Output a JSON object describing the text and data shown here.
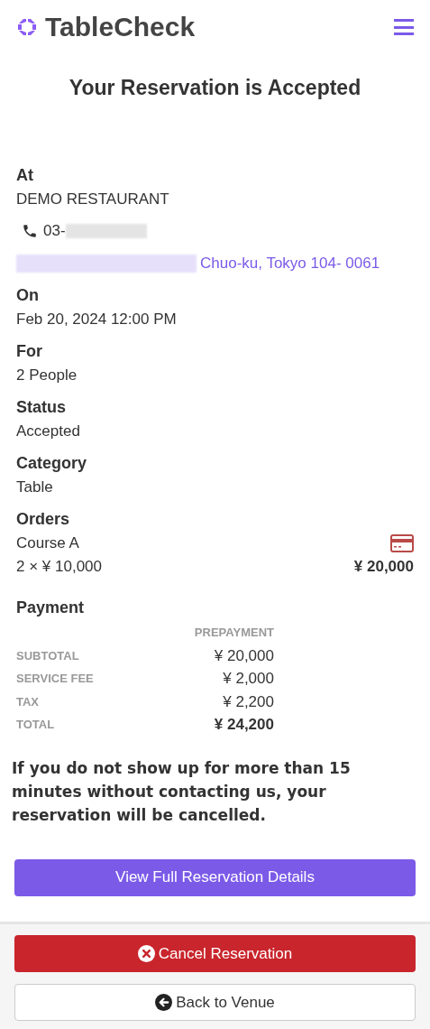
{
  "header": {
    "logo": "TableCheck"
  },
  "title": "Your Reservation is Accepted",
  "venue": {
    "label": "At",
    "name": "DEMO RESTAURANT",
    "phone": "03-",
    "address": "Chuo-ku, Tokyo 104- 0061"
  },
  "fields": [
    {
      "label": "On",
      "value": "Feb 20, 2024 12:00 PM"
    },
    {
      "label": "For",
      "value": "2 People"
    },
    {
      "label": "Status",
      "value": "Accepted"
    },
    {
      "label": "Category",
      "value": "Table"
    }
  ],
  "orders": {
    "label": "Orders",
    "items": [
      {
        "name": "Course A",
        "quantity_price": "2 × ¥ 10,000",
        "total": "¥ 20,000"
      }
    ]
  },
  "payment": {
    "label": "Payment",
    "column": "PREPAYMENT",
    "rows": [
      {
        "label": "SUBTOTAL",
        "amount": "¥ 20,000",
        "kind": "line"
      },
      {
        "label": "SERVICE FEE",
        "amount": "¥ 2,000",
        "kind": "line"
      },
      {
        "label": "TAX",
        "amount": "¥ 2,200",
        "kind": "line"
      },
      {
        "label": "TOTAL",
        "amount": "¥ 24,200",
        "kind": "total"
      }
    ]
  },
  "notice": "If you do not show up for more than 15 minutes without contacting us, your reservation will be cancelled.",
  "details_button": "View Full Reservation Details",
  "cancel_button": "Cancel Reservation",
  "back_button": "Back to Venue"
}
